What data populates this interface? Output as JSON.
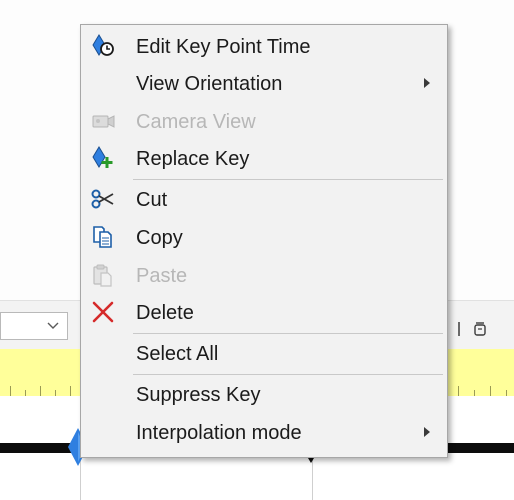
{
  "menu": {
    "items": [
      {
        "label": "Edit Key Point Time",
        "icon": "edit-key-time-icon",
        "enabled": true
      },
      {
        "label": "View Orientation",
        "icon": null,
        "enabled": true,
        "submenu": true
      },
      {
        "label": "Camera View",
        "icon": "camera-icon",
        "enabled": false
      },
      {
        "label": "Replace Key",
        "icon": "replace-key-icon",
        "enabled": true
      },
      {
        "label": "Cut",
        "icon": "scissors-icon",
        "enabled": true
      },
      {
        "label": "Copy",
        "icon": "copy-icon",
        "enabled": true
      },
      {
        "label": "Paste",
        "icon": "paste-icon",
        "enabled": false
      },
      {
        "label": "Delete",
        "icon": "delete-icon",
        "enabled": true
      },
      {
        "label": "Select All",
        "icon": null,
        "enabled": true
      },
      {
        "label": "Suppress Key",
        "icon": null,
        "enabled": true
      },
      {
        "label": "Interpolation mode",
        "icon": null,
        "enabled": true,
        "submenu": true
      }
    ]
  },
  "colors": {
    "menu_background": "#f2f2f2",
    "ruler": "#ffff9a",
    "delete_red": "#d52a2a",
    "key_blue": "#2f7fe0",
    "disabled_text": "#b7b7b7"
  }
}
